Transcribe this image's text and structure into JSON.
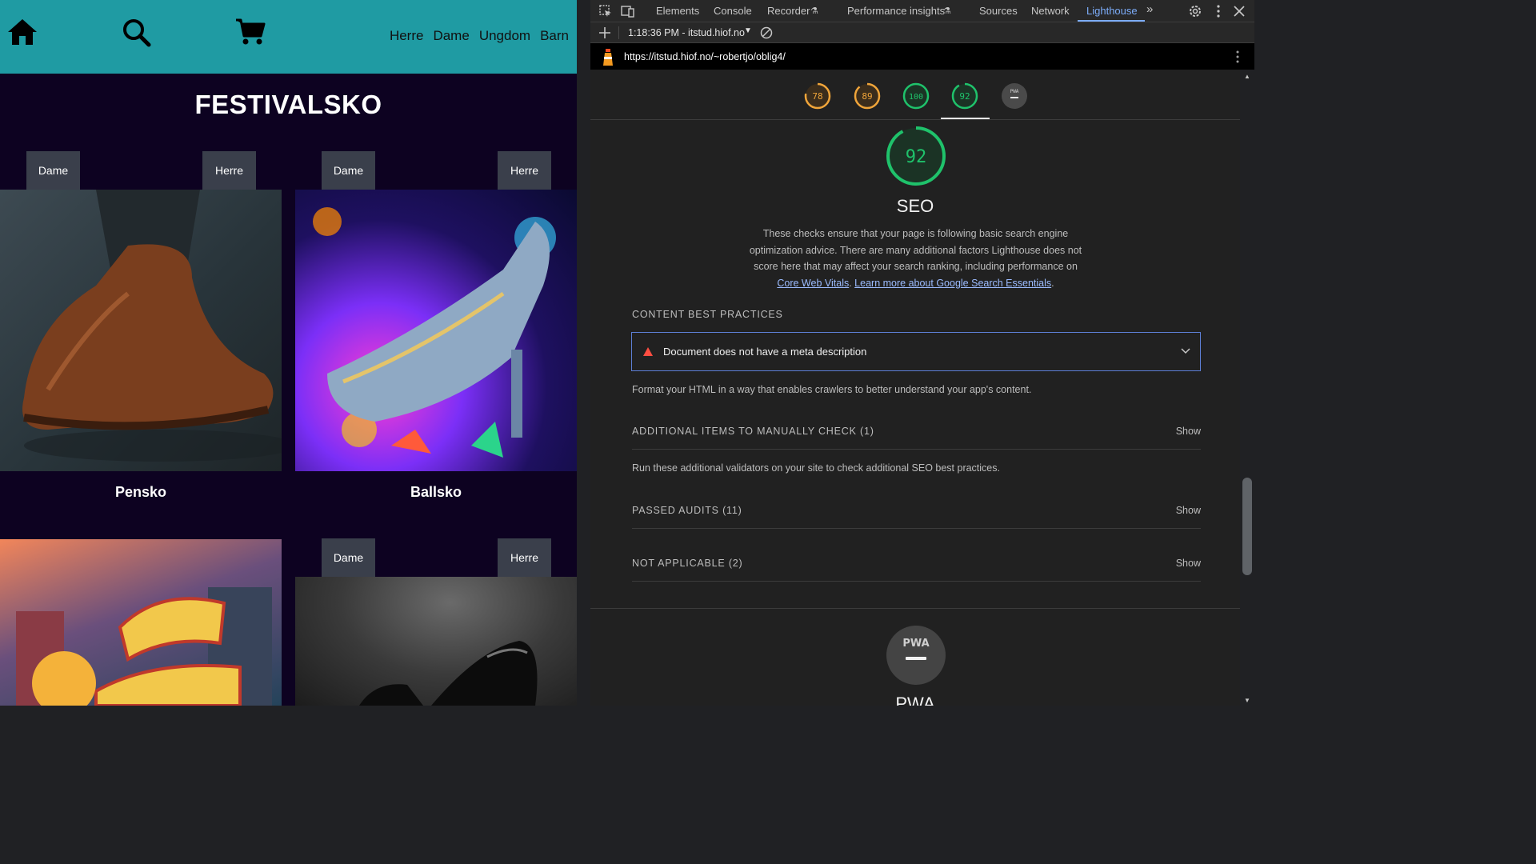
{
  "site": {
    "nav": [
      "Herre",
      "Dame",
      "Ungdom",
      "Barn"
    ],
    "title": "FESTIVALSKO",
    "tags": {
      "dame": "Dame",
      "herre": "Herre"
    },
    "products": [
      {
        "name": "Pensko"
      },
      {
        "name": "Ballsko"
      }
    ]
  },
  "devtools": {
    "tabs": [
      "Elements",
      "Console",
      "Recorder",
      "Performance insights",
      "Sources",
      "Network",
      "Lighthouse"
    ],
    "active_tab": "Lighthouse",
    "report_time": "1:18:36 PM - itstud.hiof.no",
    "url": "https://itstud.hiof.no/~robertjo/oblig4/",
    "scores": [
      {
        "value": "78",
        "color": "#f0a53a"
      },
      {
        "value": "89",
        "color": "#f0a53a"
      },
      {
        "value": "100",
        "color": "#1fc26b"
      },
      {
        "value": "92",
        "color": "#1fc26b"
      },
      {
        "value": "PWA",
        "color": "#9e9e9e"
      }
    ],
    "seo": {
      "score": "92",
      "title": "SEO",
      "desc_main": "These checks ensure that your page is following basic search engine optimization advice. There are many additional factors Lighthouse does not score here that may affect your search ranking, including performance on",
      "link1": "Core Web Vitals",
      "link2": "Learn more about Google Search Essentials",
      "content_best_practices": "CONTENT BEST PRACTICES",
      "audit_fail": "Document does not have a meta description",
      "format_note": "Format your HTML in a way that enables crawlers to better understand your app's content.",
      "manual_check": "ADDITIONAL ITEMS TO MANUALLY CHECK (1)",
      "manual_note": "Run these additional validators on your site to check additional SEO best practices.",
      "passed": "PASSED AUDITS (11)",
      "not_applicable": "NOT APPLICABLE (2)",
      "show": "Show"
    },
    "pwa": {
      "badge": "PWA",
      "title": "PWA"
    }
  }
}
